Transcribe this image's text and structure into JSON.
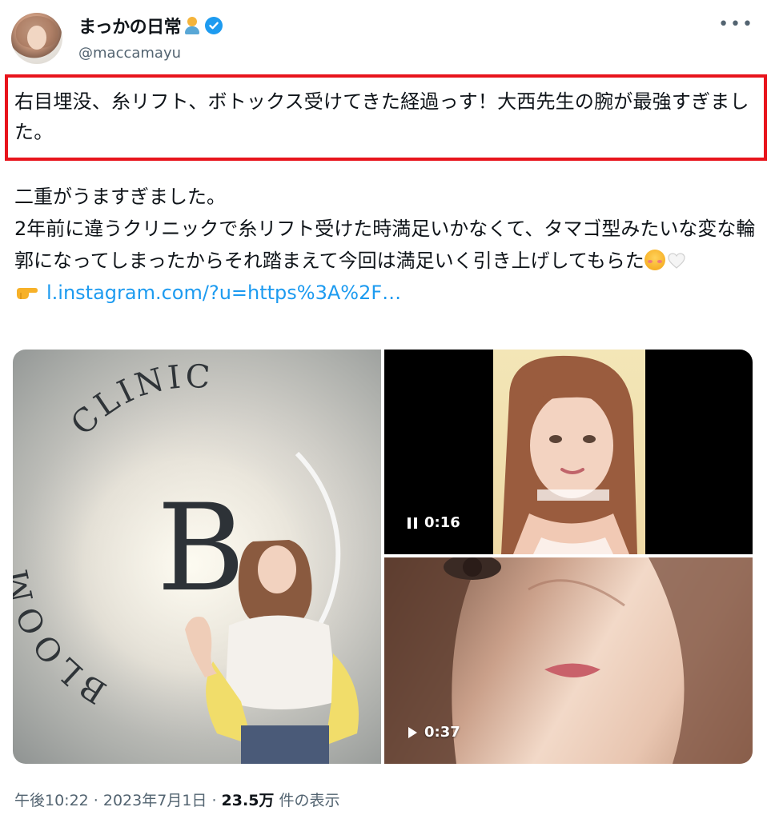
{
  "tweet": {
    "author": {
      "display_name": "まっかの日常",
      "handle": "@maccamayu",
      "verified": true
    },
    "highlighted_text": "右目埋没、糸リフト、ボトックス受けてきた経過っす！大西先生の腕が最強すぎました。",
    "body_lines": [
      "二重がうますぎました。",
      "2年前に違うクリニックで糸リフト受けた時満足いかなくて、タマゴ型みたいな変な輪郭になってしまったからそれ踏まえて今回は満足いく引き上げしてもらた"
    ],
    "link_text": "l.instagram.com/?u=https%3A%2F…",
    "media": {
      "photo_sign_text": [
        "CLINIC",
        "BLOOM",
        "B"
      ],
      "video1_duration": "0:16",
      "video2_duration": "0:37"
    },
    "meta": {
      "time": "午後10:22 · 2023年7月1日 · ",
      "views_count": "23.5万",
      "views_label": " 件の表示"
    }
  },
  "icons": [
    "verified-badge-icon",
    "more-icon",
    "pointing-hand-icon",
    "smiling-face-icon",
    "white-heart-icon",
    "pause-icon",
    "play-icon"
  ],
  "colors": {
    "accent": "#1d9bf0",
    "highlight_border": "#e8141c",
    "secondary_text": "#536471"
  }
}
